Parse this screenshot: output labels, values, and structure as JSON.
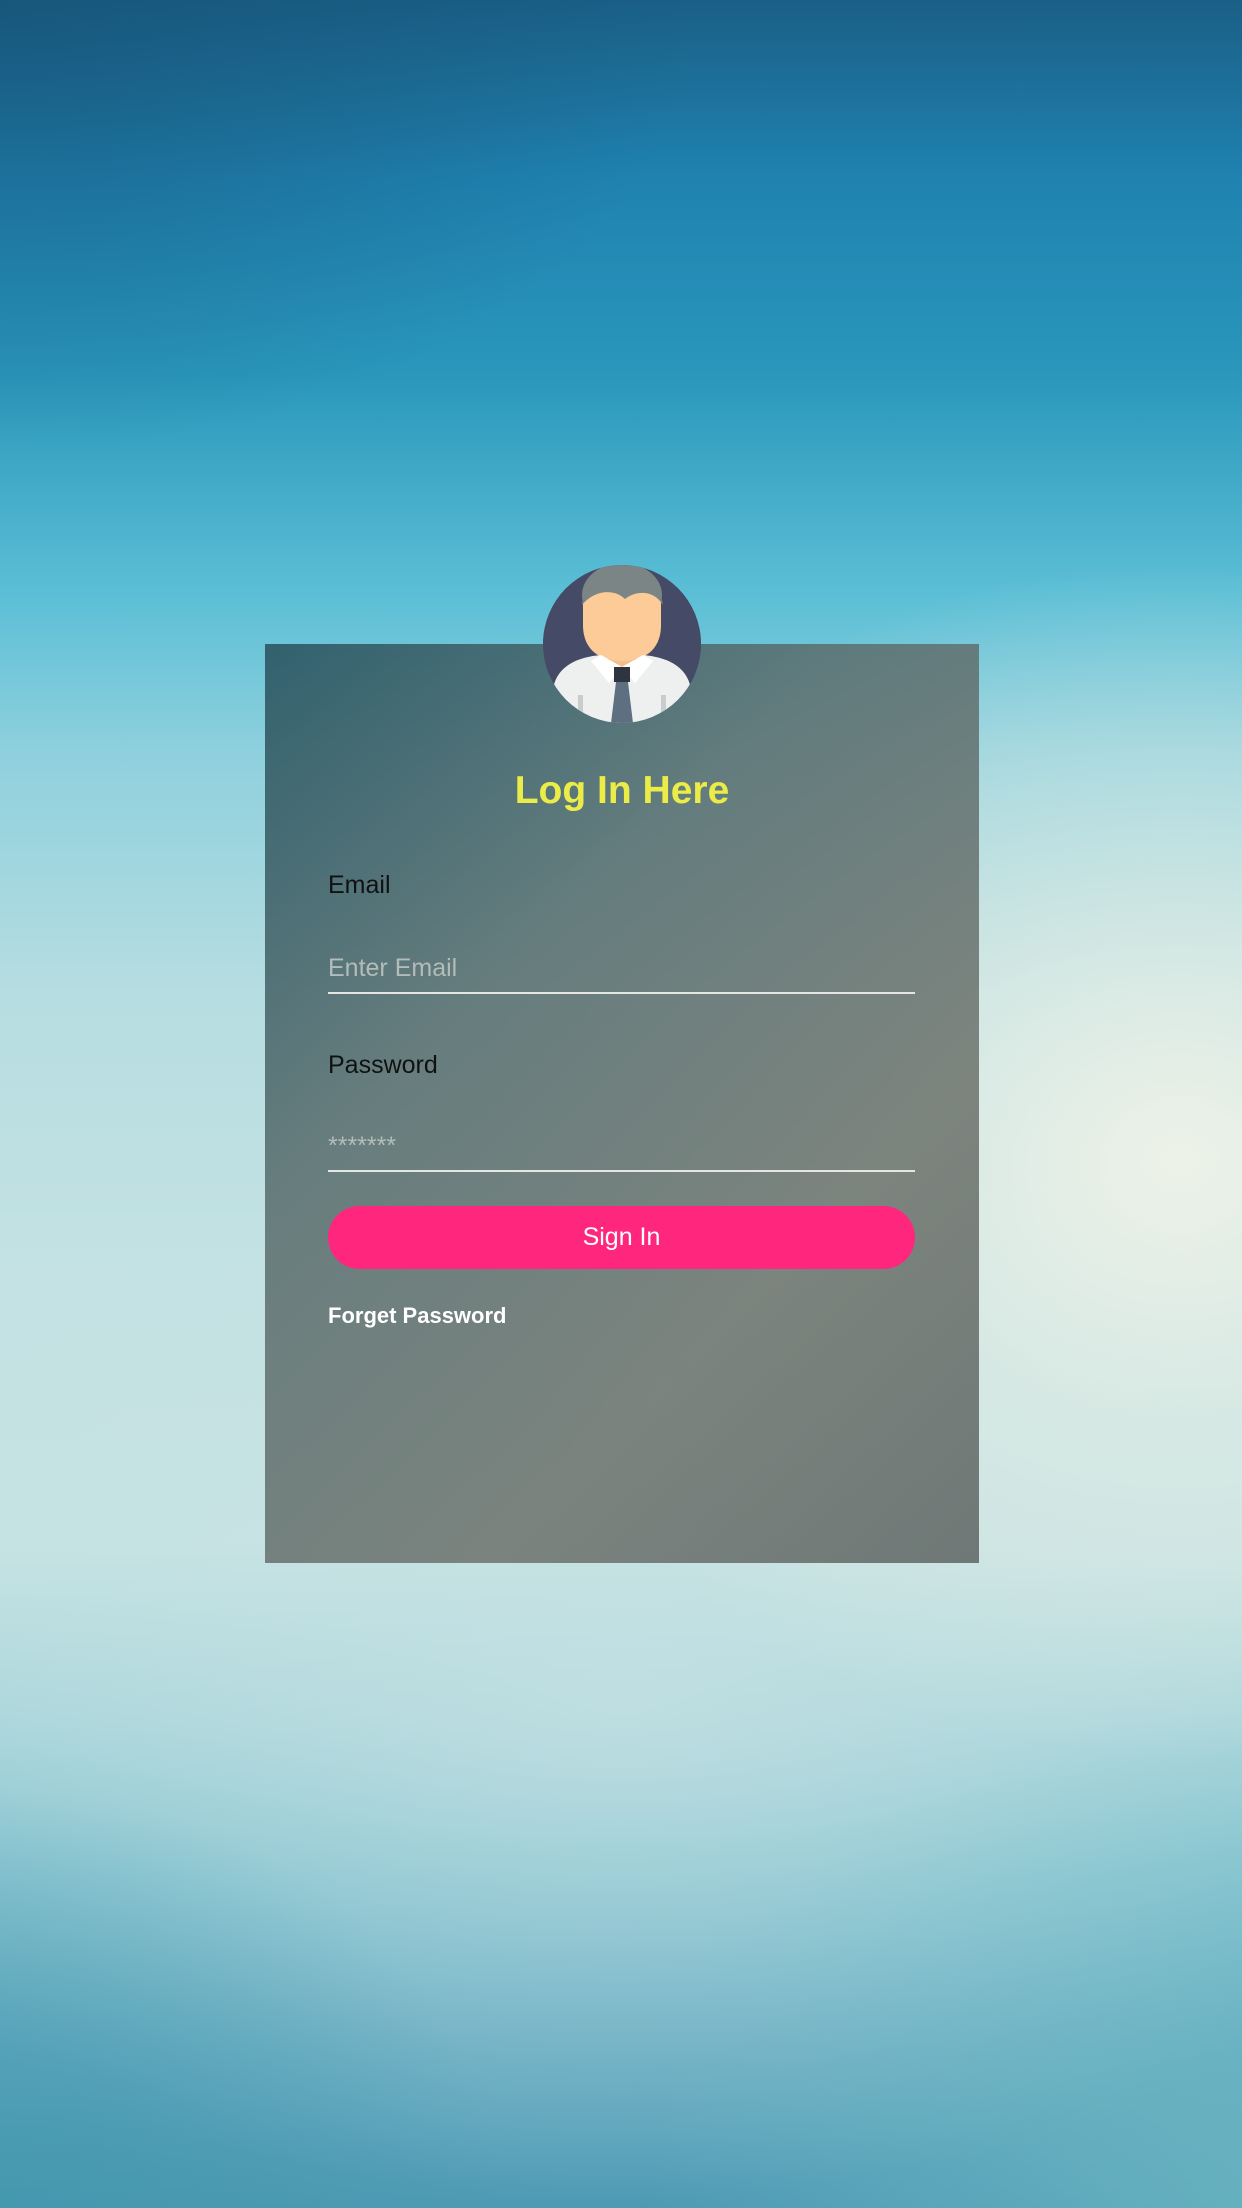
{
  "login": {
    "title": "Log In Here",
    "email_label": "Email",
    "email_placeholder": "Enter Email",
    "email_value": "",
    "password_label": "Password",
    "password_placeholder": "*******",
    "password_value": "",
    "signin_label": "Sign In",
    "forgot_label": "Forget Password",
    "avatar_icon": "user-avatar-icon"
  },
  "colors": {
    "title": "#ecec48",
    "button": "#ff267e",
    "card": "#5c7070",
    "background_top": "#1a5f86",
    "background_mid": "#c4e2e3"
  }
}
